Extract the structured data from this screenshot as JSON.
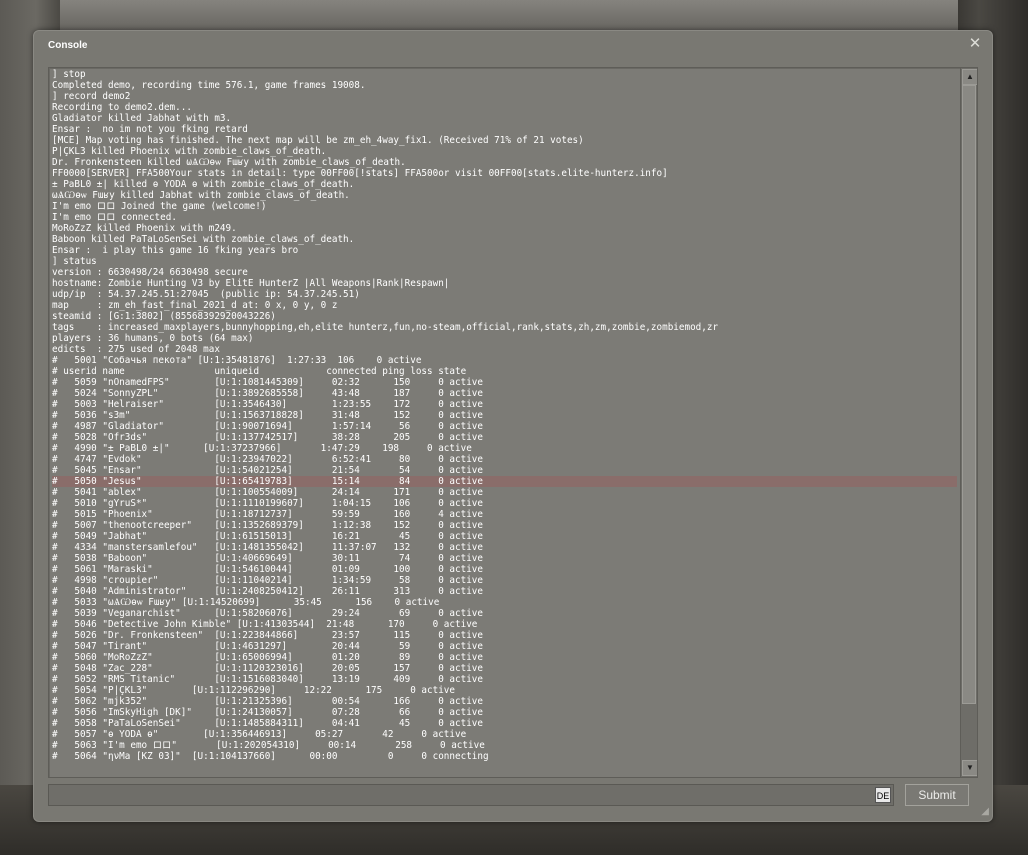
{
  "window": {
    "title": "Console",
    "close_glyph": "✕",
    "submit_label": "Submit",
    "lang_badge": "DE",
    "input_value": ""
  },
  "log_lines": [
    "] stop",
    "Completed demo, recording time 576.1, game frames 19008.",
    "] record demo2",
    "Recording to demo2.dem...",
    "Gladiator killed Jabhat with m3.",
    "Ensar :  no im not you fking retard",
    "[MCE] Map voting has finished. The next map will be zm_eh_4way_fix1. (Received 71% of 21 votes)",
    "Ρ|ÇKL3 killed Phoenix with zombie_claws_of_death.",
    "Dr. Fronkensteen killed ωѦѠѳѡ Fɯʁy with zombie_claws_of_death.",
    "FF0000[SERVER] FFA500Your stats in detail: type 00FF00[!stats] FFA500or visit 00FF00[stats.elite-hunterz.info]",
    "± PaBL0 ±| killed ɵ YODA ɵ with zombie_claws_of_death.",
    "ωѦѠѳѡ Fɯʁy killed Jabhat with zombie_claws_of_death.",
    "I'm emo ロロ Joined the game (welcome!)",
    "I'm emo ロロ connected.",
    "MoRoZzZ killed Phoenix with m249.",
    "Baboon killed PaTaLoSenSei with zombie_claws_of_death.",
    "Ensar :  i play this game 16 fking years bro",
    "] status",
    "version : 6630498/24 6630498 secure",
    "hostname: Zombie Hunting V3 by ElitE HunterZ |All Weapons|Rank|Respawn|",
    "udp/ip  : 54.37.245.51:27045  (public ip: 54.37.245.51)",
    "map     : zm_eh_fast_final_2021_d at: 0 x, 0 y, 0 z",
    "steamid : [G:1:3802] (85568392920043226)",
    "tags    : increased_maxplayers,bunnyhopping,eh,elite hunterz,fun,no-steam,official,rank,stats,zh,zm,zombie,zombiemod,zr",
    "players : 36 humans, 0 bots (64 max)",
    "edicts  : 275 used of 2048 max",
    "#   5001 \"Собачья пекота\" [U:1:35481876]  1:27:33  106    0 active",
    "# userid name                uniqueid            connected ping loss state",
    "#   5059 \"nOnamedFPS\"        [U:1:1081445309]     02:32      150     0 active",
    "#   5024 \"SonnyZPL\"          [U:1:3892685558]     43:48      187     0 active",
    "#   5003 \"Helraiser\"         [U:1:3546430]        1:23:55    172     0 active",
    "#   5036 \"s3m\"               [U:1:1563718828]     31:48      152     0 active",
    "#   4987 \"Gladiator\"         [U:1:90071694]       1:57:14     56     0 active",
    "#   5028 \"Ofr3ds\"            [U:1:137742517]      38:28      205     0 active",
    "#   4990 \"± PaBL0 ±|\"      [U:1:37237966]       1:47:29    198     0 active",
    "#   4747 \"Evdok\"             [U:1:23947022]       6:52:41     80     0 active",
    "#   5045 \"Ensar\"             [U:1:54021254]       21:54       54     0 active",
    "#   5050 \"Jesus\"             [U:1:65419783]       15:14       84     0 active",
    "#   5041 \"ablex\"             [U:1:100554009]      24:14      171     0 active",
    "#   5010 \"gYruS*\"            [U:1:1110199607]     1:04:15    106     0 active",
    "#   5015 \"Phoenix\"           [U:1:18712737]       59:59      160     4 active",
    "#   5007 \"thenootcreeper\"    [U:1:1352689379]     1:12:38    152     0 active",
    "#   5049 \"Jabhat\"            [U:1:61515013]       16:21       45     0 active",
    "#   4334 \"manstersamlefou\"   [U:1:1481355042]     11:37:07   132     0 active",
    "#   5038 \"Baboon\"            [U:1:40669649]       30:11       74     0 active",
    "#   5061 \"Maraski\"           [U:1:54610044]       01:09      100     0 active",
    "#   4998 \"croupier\"          [U:1:11040214]       1:34:59     58     0 active",
    "#   5040 \"Administrator\"     [U:1:2408250412]     26:11      313     0 active",
    "#   5033 \"ωѦѠѳѡ Fɯʁy\" [U:1:14520699]      35:45      156    0 active",
    "#   5039 \"Veganarchist\"      [U:1:58206076]       29:24       69     0 active",
    "#   5046 \"Detective John Kimble\" [U:1:41303544]  21:48      170     0 active",
    "#   5026 \"Dr. Fronkensteen\"  [U:1:223844866]      23:57      115     0 active",
    "#   5047 \"Tirant\"            [U:1:4631297]        20:44       59     0 active",
    "#   5060 \"MoRoZzZ\"           [U:1:65006994]       01:20       89     0 active",
    "#   5048 \"Zac_228\"           [U:1:1120323016]     20:05      157     0 active",
    "#   5052 \"RMS Titanic\"       [U:1:1516083040]     13:19      409     0 active",
    "#   5054 \"Ρ|ÇKL3\"        [U:1:112296290]     12:22      175     0 active",
    "#   5062 \"mjk352\"            [U:1:21325396]       00:54      166     0 active",
    "#   5056 \"ImSkyHigh [DK]\"    [U:1:24130057]       07:28       66     0 active",
    "#   5058 \"PaTaLoSenSei\"      [U:1:1485884311]     04:41       45     0 active",
    "#   5057 \"ɵ YODA ɵ\"        [U:1:356446913]     05:27       42     0 active",
    "#   5063 \"I'm emo ロロ\"       [U:1:202054310]     00:14       258     0 active",
    "#   5064 \"ηνМа [KZ 03]\"  [U:1:104137660]      00:00         0     0 connecting"
  ],
  "highlight_line_index": 37,
  "icons": {
    "scroll_up": "scroll-up-arrow-icon",
    "scroll_down": "scroll-down-arrow-icon",
    "resize": "resize-grip-icon",
    "close": "close-icon"
  }
}
